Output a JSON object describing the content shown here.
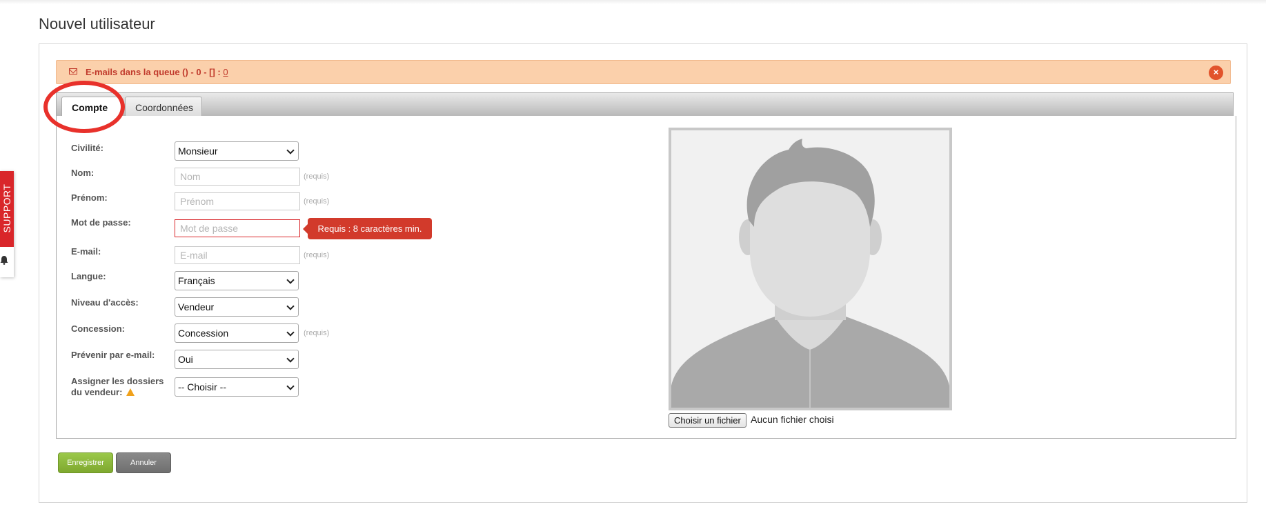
{
  "page": {
    "title": "Nouvel utilisateur"
  },
  "alert": {
    "text": "E-mails dans la queue () - 0 - [] : ",
    "link": "0",
    "close_icon": "×"
  },
  "tabs": [
    {
      "label": "Compte",
      "active": true
    },
    {
      "label": "Coordonnées",
      "active": false
    }
  ],
  "form": {
    "civilite": {
      "label": "Civilité:",
      "value": "Monsieur"
    },
    "nom": {
      "label": "Nom:",
      "placeholder": "Nom",
      "hint": "(requis)"
    },
    "prenom": {
      "label": "Prénom:",
      "placeholder": "Prénom",
      "hint": "(requis)"
    },
    "password": {
      "label": "Mot de passe:",
      "placeholder": "Mot de passe",
      "error": "Requis : 8 caractères min."
    },
    "email": {
      "label": "E-mail:",
      "placeholder": "E-mail",
      "hint": "(requis)"
    },
    "langue": {
      "label": "Langue:",
      "value": "Français"
    },
    "niveau": {
      "label": "Niveau d'accès:",
      "value": "Vendeur"
    },
    "concession": {
      "label": "Concession:",
      "value": "Concession",
      "hint": "(requis)"
    },
    "prevenir": {
      "label": "Prévenir par e-mail:",
      "value": "Oui"
    },
    "assigner": {
      "label_line1": "Assigner les dossiers",
      "label_line2": "du vendeur:",
      "value": "-- Choisir --"
    }
  },
  "photo": {
    "button": "Choisir un fichier",
    "status": "Aucun fichier choisi"
  },
  "actions": {
    "save": "Enregistrer",
    "cancel": "Annuler"
  },
  "support": {
    "label": "SUPPORT"
  },
  "colors": {
    "accent_red": "#d9262a",
    "alert_bg": "#fbd0ab",
    "save_green": "#8cb83d",
    "cancel_gray": "#7a7a7a"
  },
  "icons": {
    "alert": "mail-icon",
    "close": "close-icon",
    "warning": "warning-icon",
    "bell": "bell-icon"
  }
}
